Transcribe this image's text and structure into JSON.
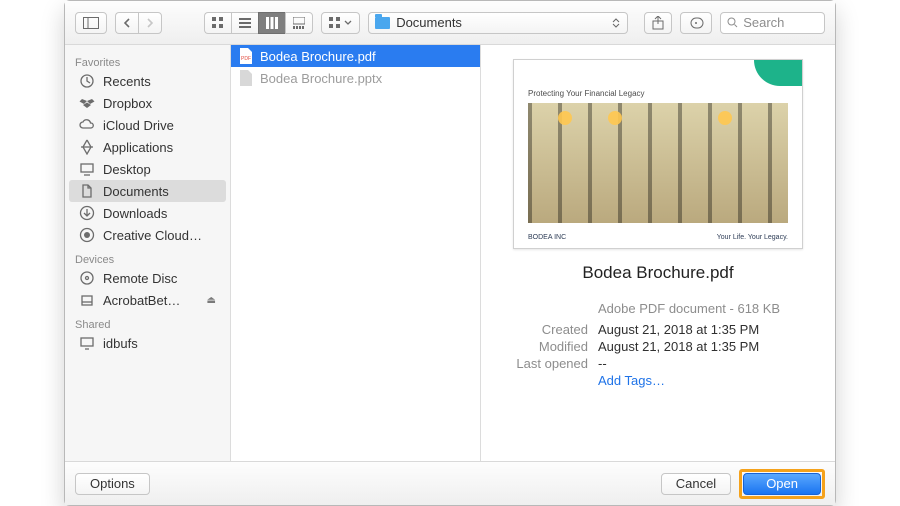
{
  "toolbar": {
    "folder_label": "Documents",
    "search_placeholder": "Search"
  },
  "sidebar": {
    "sections": [
      {
        "title": "Favorites",
        "items": [
          {
            "icon": "clock",
            "label": "Recents"
          },
          {
            "icon": "dropbox",
            "label": "Dropbox"
          },
          {
            "icon": "cloud",
            "label": "iCloud Drive"
          },
          {
            "icon": "apps",
            "label": "Applications"
          },
          {
            "icon": "desktop",
            "label": "Desktop"
          },
          {
            "icon": "doc",
            "label": "Documents",
            "selected": true
          },
          {
            "icon": "download",
            "label": "Downloads"
          },
          {
            "icon": "creative",
            "label": "Creative Cloud…"
          }
        ]
      },
      {
        "title": "Devices",
        "items": [
          {
            "icon": "disc",
            "label": "Remote Disc"
          },
          {
            "icon": "disk",
            "label": "AcrobatBet…",
            "eject": true
          }
        ]
      },
      {
        "title": "Shared",
        "items": [
          {
            "icon": "screen",
            "label": "idbufs"
          }
        ]
      }
    ]
  },
  "files": [
    {
      "icon": "pdf",
      "name": "Bodea Brochure.pdf",
      "selected": true
    },
    {
      "icon": "pptx",
      "name": "Bodea Brochure.pptx",
      "dim": true
    }
  ],
  "preview": {
    "thumb_caption": "Protecting Your Financial Legacy",
    "thumb_brand": "BODEA INC",
    "thumb_tag": "Your Life. Your Legacy.",
    "title": "Bodea Brochure.pdf",
    "kind": "Adobe PDF document - 618 KB",
    "labels": {
      "created": "Created",
      "modified": "Modified",
      "lastopened": "Last opened"
    },
    "created": "August 21, 2018 at 1:35 PM",
    "modified": "August 21, 2018 at 1:35 PM",
    "lastopened": "--",
    "add_tags": "Add Tags…"
  },
  "footer": {
    "options_label": "Options",
    "cancel_label": "Cancel",
    "open_label": "Open"
  }
}
